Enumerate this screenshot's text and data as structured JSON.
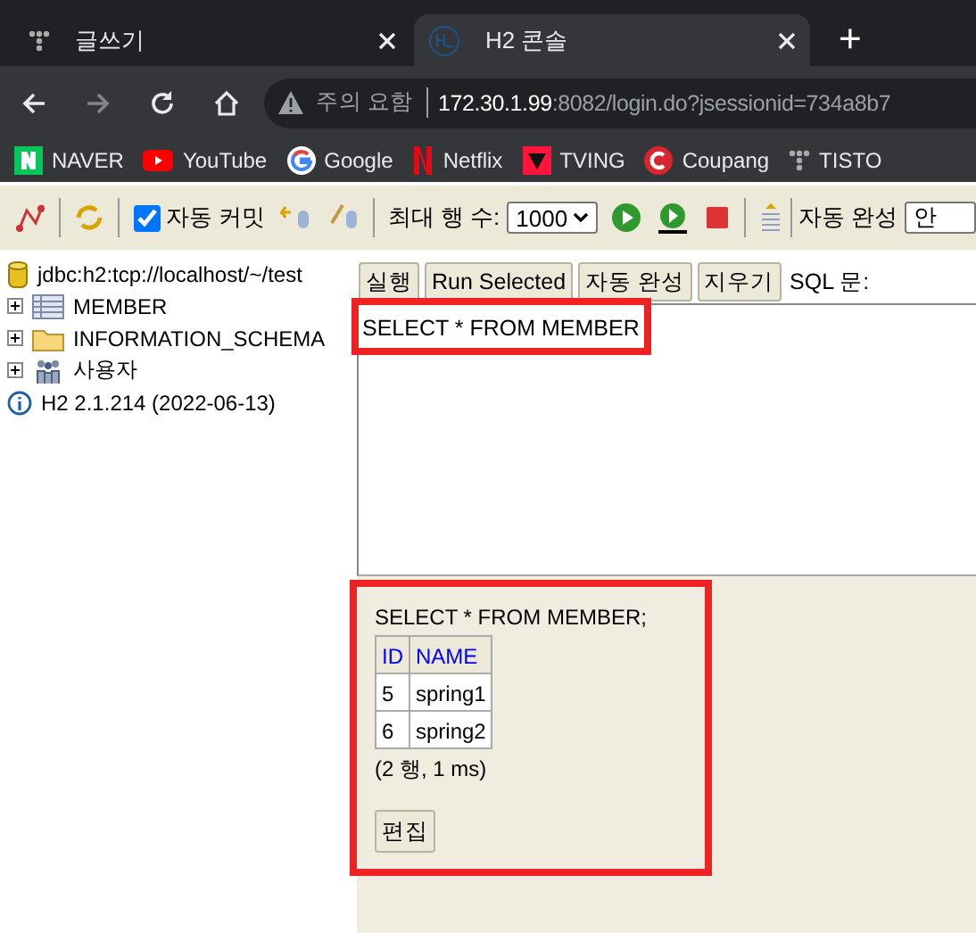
{
  "browser": {
    "tabs": [
      {
        "title": "글쓰기",
        "selected": false,
        "kind": "dots"
      },
      {
        "title": "H2 콘솔",
        "selected": true,
        "kind": "h2"
      }
    ],
    "new_tab": "+",
    "security": "주의 요함",
    "url_host": "172.30.1.99",
    "url_rest": ":8082/login.do?jsessionid=734a8b7",
    "bookmarks": [
      {
        "label": "NAVER",
        "kind": "naver"
      },
      {
        "label": "YouTube",
        "kind": "youtube"
      },
      {
        "label": "Google",
        "kind": "google"
      },
      {
        "label": "Netflix",
        "kind": "netflix"
      },
      {
        "label": "TVING",
        "kind": "tving"
      },
      {
        "label": "Coupang",
        "kind": "coupang"
      },
      {
        "label": "TISTO",
        "kind": "dots"
      }
    ]
  },
  "toolbar": {
    "auto_commit": {
      "label": "자동 커밋",
      "checked": true
    },
    "max_rows_label": "최대 행 수:",
    "max_rows": "1000",
    "autocomplete_label": "자동 완성",
    "autocomplete_value": "안"
  },
  "tree": [
    {
      "kind": "database",
      "label": "jdbc:h2:tcp://localhost/~/test"
    },
    {
      "kind": "table",
      "label": "MEMBER",
      "expanded": false
    },
    {
      "kind": "folder",
      "label": "INFORMATION_SCHEMA",
      "expanded": false
    },
    {
      "kind": "users",
      "label": "사용자",
      "expanded": false
    },
    {
      "kind": "info",
      "label": "H2 2.1.214 (2022-06-13)"
    }
  ],
  "query": {
    "buttons": [
      "실행",
      "Run Selected",
      "자동 완성",
      "지우기"
    ],
    "sql_label": "SQL 문:",
    "sql": "SELECT * FROM MEMBER"
  },
  "result": {
    "statement": "SELECT * FROM MEMBER;",
    "columns": [
      "ID",
      "NAME"
    ],
    "rows": [
      [
        "5",
        "spring1"
      ],
      [
        "6",
        "spring2"
      ]
    ],
    "summary": "(2 행, 1 ms)",
    "edit_button": "편집"
  }
}
